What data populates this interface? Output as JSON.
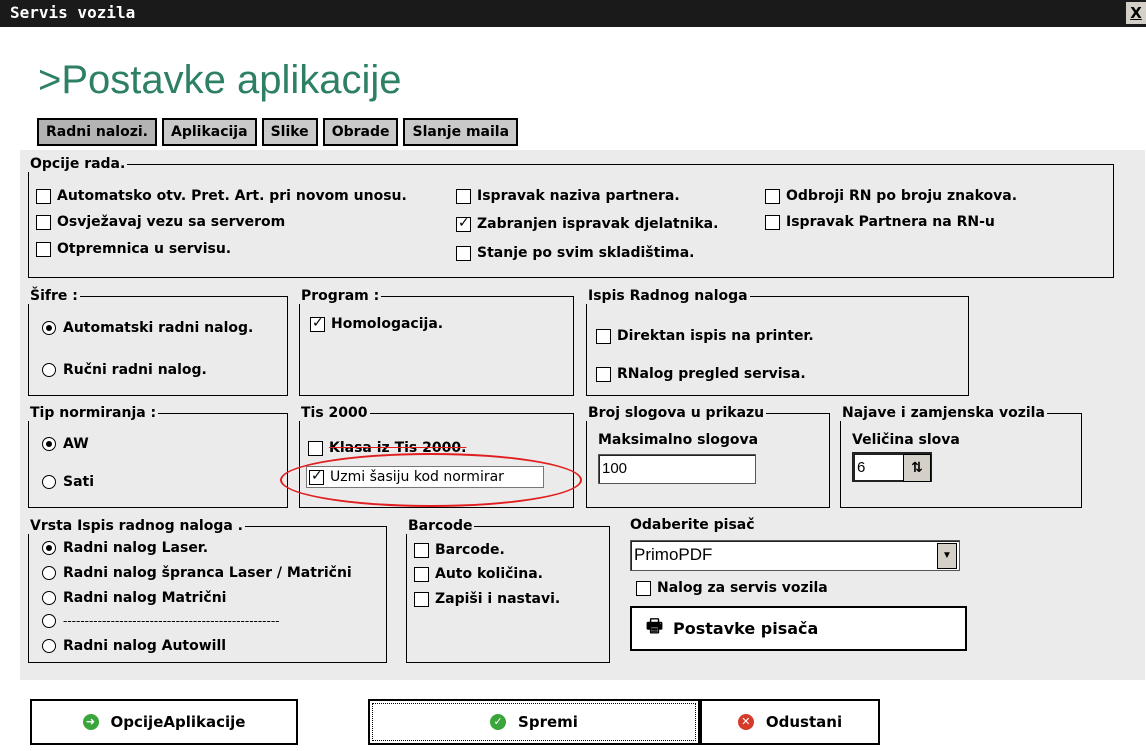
{
  "window": {
    "title": "Servis vozila",
    "close_label": "X"
  },
  "page_title": ">Postavke aplikacije",
  "tabs": [
    "Radni nalozi.",
    "Aplikacija",
    "Slike",
    "Obrade",
    "Slanje maila"
  ],
  "opcije": {
    "legend": "Opcije rada.",
    "items": [
      {
        "label": "Automatsko otv. Pret. Art. pri novom unosu.",
        "checked": false
      },
      {
        "label": "Osvježavaj vezu sa serverom",
        "checked": false
      },
      {
        "label": "Otpremnica u servisu.",
        "checked": false
      },
      {
        "label": "Ispravak naziva partnera.",
        "checked": false
      },
      {
        "label": "Zabranjen ispravak djelatnika.",
        "checked": true
      },
      {
        "label": "Stanje po svim skladištima.",
        "checked": false
      },
      {
        "label": "Odbroji RN po broju znakova.",
        "checked": false
      },
      {
        "label": "Ispravak Partnera na RN-u",
        "checked": false
      }
    ]
  },
  "sifre": {
    "legend": "Šifre :",
    "options": [
      "Automatski radni nalog.",
      "Ručni radni nalog."
    ],
    "selected": 0
  },
  "program": {
    "legend": "Program :",
    "items": [
      {
        "label": "Homologacija.",
        "checked": true
      }
    ]
  },
  "ispis_rn": {
    "legend": "Ispis Radnog naloga",
    "items": [
      {
        "label": "Direktan ispis na printer.",
        "checked": false
      },
      {
        "label": "RNalog pregled servisa.",
        "checked": false
      }
    ]
  },
  "tip_norm": {
    "legend": "Tip normiranja :",
    "options": [
      "AW",
      "Sati"
    ],
    "selected": 0
  },
  "tis": {
    "legend": "Tis 2000",
    "items": [
      {
        "label": "Klasa iz Tis 2000.",
        "checked": false
      },
      {
        "label": "Uzmi šasiju kod normirar",
        "checked": true
      }
    ]
  },
  "broj": {
    "legend": "Broj slogova u prikazu",
    "label": "Maksimalno slogova",
    "value": "100"
  },
  "najave": {
    "legend": "Najave i zamjenska vozila",
    "label": "Veličina slova",
    "value": "6"
  },
  "vrsta": {
    "legend": "Vrsta Ispis radnog naloga .",
    "options": [
      "Radni nalog Laser.",
      "Radni nalog špranca Laser / Matrični",
      "Radni nalog Matrični",
      "--------------------------------------------------",
      "Radni nalog Autowill"
    ],
    "selected": 0
  },
  "barcode": {
    "legend": "Barcode",
    "items": [
      {
        "label": "Barcode.",
        "checked": false
      },
      {
        "label": "Auto količina.",
        "checked": false
      },
      {
        "label": "Zapiši i nastavi.",
        "checked": false
      }
    ]
  },
  "pisac": {
    "label": "Odaberite pisač",
    "value": "PrimoPDF",
    "nalog_label": "Nalog za servis vozila",
    "nalog_checked": false,
    "button_label": "Postavke pisača"
  },
  "footer": {
    "opcije_label": "OpcijeAplikacije",
    "spremi_label": "Spremi",
    "odustani_label": "Odustani"
  },
  "colors": {
    "title": "#2d7f66",
    "panel": "#ebebeb",
    "highlight": "#e01e1e"
  }
}
